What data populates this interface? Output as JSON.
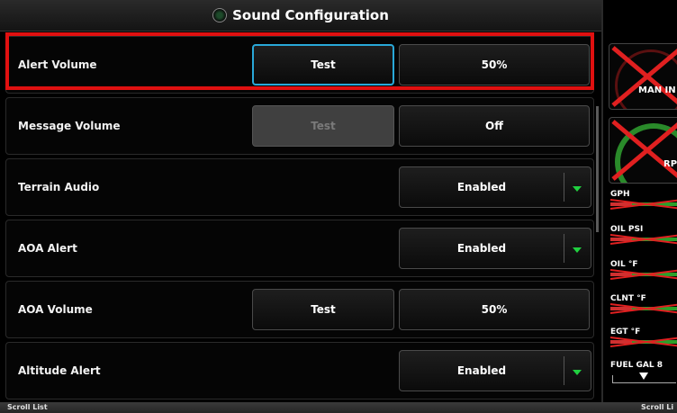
{
  "window": {
    "title": "Sound Configuration"
  },
  "rows": [
    {
      "label": "Alert Volume",
      "test_label": "Test",
      "value": "50%"
    },
    {
      "label": "Message Volume",
      "test_label": "Test",
      "value": "Off"
    },
    {
      "label": "Terrain Audio",
      "value": "Enabled"
    },
    {
      "label": "AOA Alert",
      "value": "Enabled"
    },
    {
      "label": "AOA Volume",
      "test_label": "Test",
      "value": "50%"
    },
    {
      "label": "Altitude Alert",
      "value": "Enabled"
    }
  ],
  "status_bar": {
    "left_label": "Scroll List",
    "right_label": "Scroll Li"
  },
  "engine_panel": {
    "gauges": [
      {
        "label": "MAN IN"
      },
      {
        "label": "RPM"
      }
    ],
    "indicators": [
      "GPH",
      "OIL PSI",
      "OIL °F",
      "CLNT °F",
      "EGT °F"
    ],
    "fuel_label": "FUEL GAL",
    "fuel_trailing": "8"
  },
  "colors": {
    "focus_border": "#29a8d8",
    "selection_highlight": "#e01010",
    "dropdown_arrow": "#20d040",
    "invalid_mark": "#e02020"
  }
}
